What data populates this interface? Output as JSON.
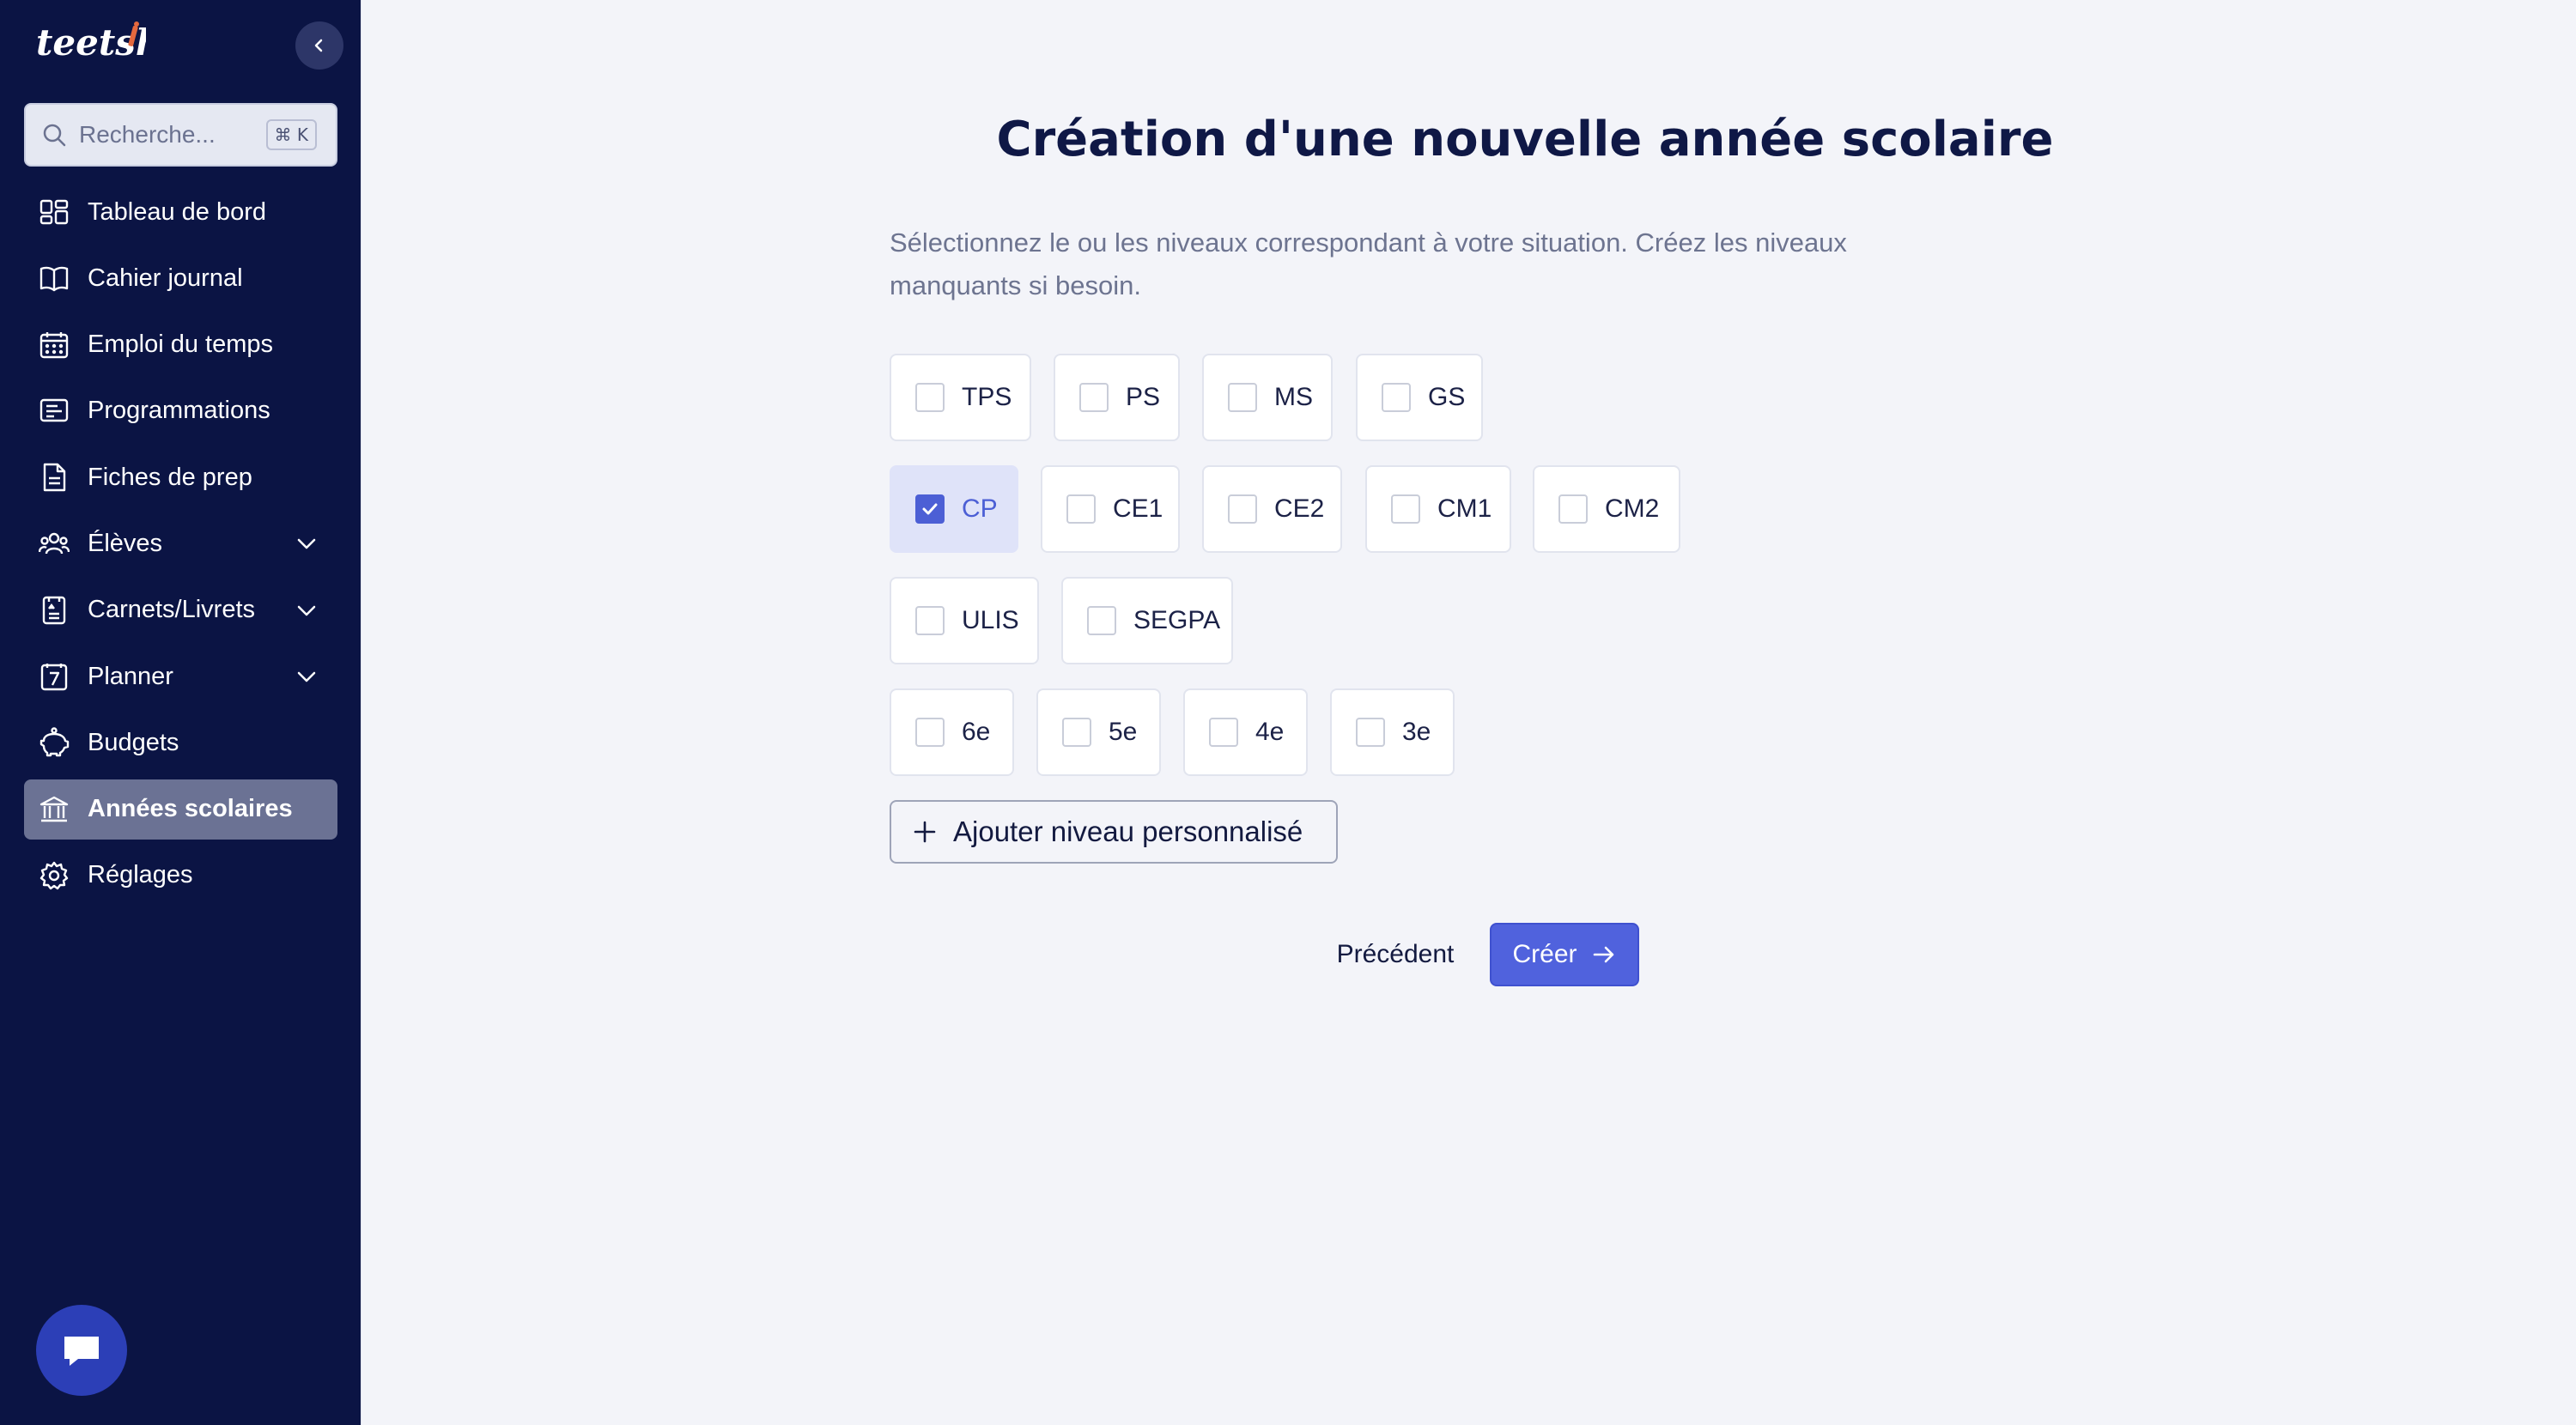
{
  "app": {
    "logo_text": "teetshi"
  },
  "sidebar": {
    "search": {
      "placeholder": "Recherche...",
      "shortcut": "⌘ K"
    },
    "items": [
      {
        "label": "Tableau de bord",
        "icon": "dashboard-icon"
      },
      {
        "label": "Cahier journal",
        "icon": "book-icon"
      },
      {
        "label": "Emploi du temps",
        "icon": "calendar-icon"
      },
      {
        "label": "Programmations",
        "icon": "programmations-icon"
      },
      {
        "label": "Fiches de prep",
        "icon": "document-icon"
      },
      {
        "label": "Élèves",
        "icon": "users-icon",
        "expandable": true
      },
      {
        "label": "Carnets/Livrets",
        "icon": "notebook-icon",
        "expandable": true
      },
      {
        "label": "Planner",
        "icon": "planner-icon",
        "expandable": true
      },
      {
        "label": "Budgets",
        "icon": "piggy-bank-icon"
      },
      {
        "label": "Années scolaires",
        "icon": "school-icon",
        "active": true
      },
      {
        "label": "Réglages",
        "icon": "gear-icon"
      }
    ]
  },
  "main": {
    "title": "Création d'une nouvelle année scolaire",
    "subtitle": "Sélectionnez le ou les niveaux correspondant à votre situation. Créez les niveaux manquants si besoin.",
    "levels": [
      {
        "label": "TPS",
        "checked": false
      },
      {
        "label": "PS",
        "checked": false
      },
      {
        "label": "MS",
        "checked": false
      },
      {
        "label": "GS",
        "checked": false
      },
      {
        "label": "CP",
        "checked": true
      },
      {
        "label": "CE1",
        "checked": false
      },
      {
        "label": "CE2",
        "checked": false
      },
      {
        "label": "CM1",
        "checked": false
      },
      {
        "label": "CM2",
        "checked": false
      },
      {
        "label": "ULIS",
        "checked": false
      },
      {
        "label": "SEGPA",
        "checked": false
      },
      {
        "label": "6e",
        "checked": false
      },
      {
        "label": "5e",
        "checked": false
      },
      {
        "label": "4e",
        "checked": false
      },
      {
        "label": "3e",
        "checked": false
      }
    ],
    "add_custom_label": "Ajouter niveau personnalisé",
    "previous_label": "Précédent",
    "create_label": "Créer"
  },
  "colors": {
    "sidebar_bg": "#0b1444",
    "accent": "#5062dd",
    "page_bg": "#f3f4f9"
  }
}
